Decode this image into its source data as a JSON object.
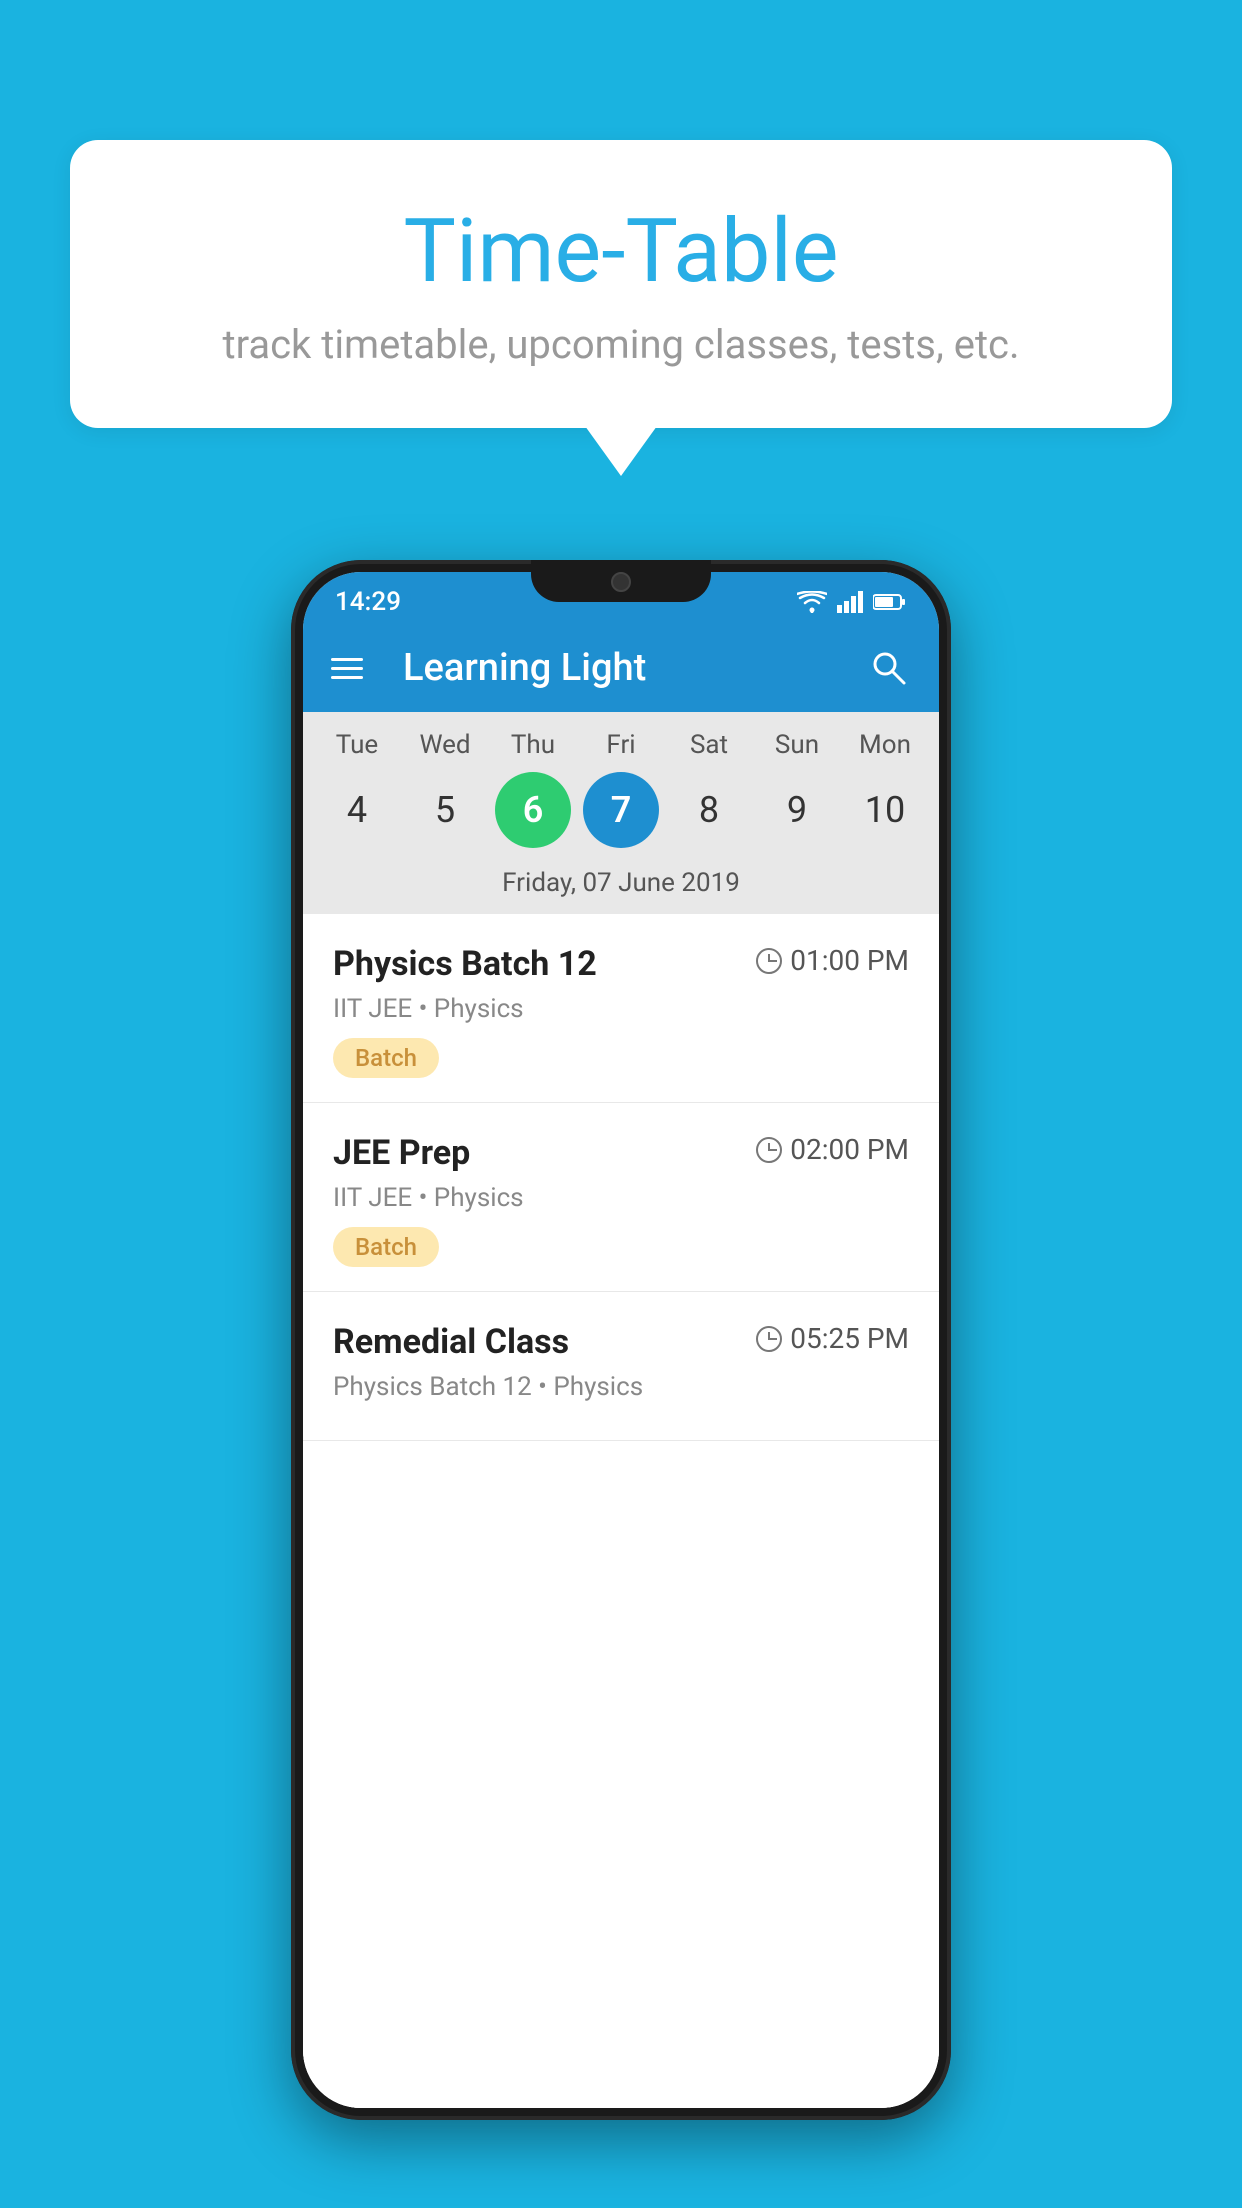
{
  "background_color": "#1ab3e0",
  "speech_bubble": {
    "title": "Time-Table",
    "subtitle": "track timetable, upcoming classes, tests, etc."
  },
  "phone": {
    "status_bar": {
      "time": "14:29"
    },
    "app_bar": {
      "title": "Learning Light"
    },
    "calendar": {
      "days": [
        {
          "label": "Tue",
          "num": "4"
        },
        {
          "label": "Wed",
          "num": "5"
        },
        {
          "label": "Thu",
          "num": "6",
          "state": "today-green"
        },
        {
          "label": "Fri",
          "num": "7",
          "state": "selected-blue"
        },
        {
          "label": "Sat",
          "num": "8"
        },
        {
          "label": "Sun",
          "num": "9"
        },
        {
          "label": "Mon",
          "num": "10"
        }
      ],
      "selected_date_label": "Friday, 07 June 2019"
    },
    "schedule": [
      {
        "title": "Physics Batch 12",
        "time": "01:00 PM",
        "subtitle": "IIT JEE • Physics",
        "badge": "Batch"
      },
      {
        "title": "JEE Prep",
        "time": "02:00 PM",
        "subtitle": "IIT JEE • Physics",
        "badge": "Batch"
      },
      {
        "title": "Remedial Class",
        "time": "05:25 PM",
        "subtitle": "Physics Batch 12 • Physics",
        "badge": ""
      }
    ]
  }
}
